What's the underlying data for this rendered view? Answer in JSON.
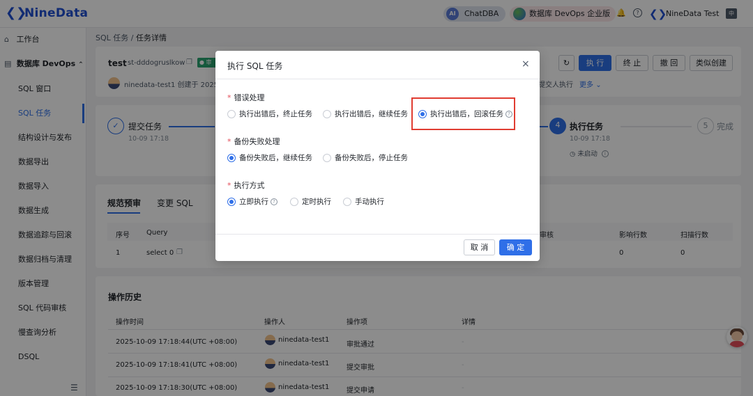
{
  "app": {
    "logo_text": "NineData",
    "chatdba": "ChatDBA",
    "chatdba_avatar": "AI",
    "devops_edition": "数据库 DevOps 企业版",
    "username": "NineData Test",
    "lang_icon": "中"
  },
  "sidebar": {
    "items": [
      {
        "label": "工作台",
        "icon": "home-icon"
      },
      {
        "label": "数据库 DevOps",
        "icon": "devops-icon"
      },
      {
        "label": "SQL 窗口"
      },
      {
        "label": "SQL 任务"
      },
      {
        "label": "结构设计与发布"
      },
      {
        "label": "数据导出"
      },
      {
        "label": "数据导入"
      },
      {
        "label": "数据生成"
      },
      {
        "label": "数据追踪与回滚"
      },
      {
        "label": "数据归档与清理"
      },
      {
        "label": "版本管理"
      },
      {
        "label": "SQL 代码审核"
      },
      {
        "label": "慢查询分析"
      },
      {
        "label": "DSQL"
      }
    ]
  },
  "breadcrumb": {
    "parent": "SQL 任务",
    "sep": "/",
    "current": "任务详情"
  },
  "task": {
    "name": "test",
    "id": "st-dddogruslkow",
    "status_badge": "审",
    "creator_text": "ninedata-test1 创建于 2025",
    "submitter_text": "提交人执行",
    "more": "更多",
    "buttons": {
      "refresh": "↻",
      "execute": "执 行",
      "terminate": "终 止",
      "revoke": "撤 回",
      "clone": "类似创建"
    }
  },
  "steps": [
    {
      "title": "提交任务",
      "time": "10-09 17:18"
    },
    {
      "num": "4",
      "title": "执行任务",
      "time": "10-09 17:18",
      "status": "未启动"
    },
    {
      "num": "5",
      "title": "完成"
    }
  ],
  "tabs": [
    "规范预审",
    "变更 SQL"
  ],
  "sql_table": {
    "headers": {
      "seq": "序号",
      "query": "Query",
      "review": "审核",
      "affected": "影响行数",
      "scanned": "扫描行数"
    },
    "rows": [
      {
        "seq": "1",
        "query": "select 0",
        "affected": "0",
        "scanned": "0"
      }
    ]
  },
  "history": {
    "title": "操作历史",
    "headers": {
      "time": "操作时间",
      "operator": "操作人",
      "action": "操作项",
      "detail": "详情"
    },
    "rows": [
      {
        "time": "2025-10-09 17:18:44(UTC +08:00)",
        "operator": "ninedata-test1",
        "action": "审批通过",
        "detail": "-"
      },
      {
        "time": "2025-10-09 17:18:41(UTC +08:00)",
        "operator": "ninedata-test1",
        "action": "提交审批",
        "detail": "-"
      },
      {
        "time": "2025-10-09 17:18:30(UTC +08:00)",
        "operator": "ninedata-test1",
        "action": "提交申请",
        "detail": "-"
      }
    ]
  },
  "modal": {
    "title": "执行 SQL 任务",
    "close": "×",
    "error_handling": {
      "label": "错误处理",
      "options": [
        "执行出错后，终止任务",
        "执行出错后，继续任务",
        "执行出错后，回滚任务"
      ],
      "selected": 2
    },
    "backup_failure": {
      "label": "备份失败处理",
      "options": [
        "备份失败后，继续任务",
        "备份失败后，停止任务"
      ],
      "selected": 0
    },
    "exec_mode": {
      "label": "执行方式",
      "options": [
        "立即执行",
        "定时执行",
        "手动执行"
      ],
      "selected": 0
    },
    "cancel": "取 消",
    "confirm": "确 定"
  },
  "colors": {
    "primary": "#2f6fe8",
    "highlight": "#e03c31",
    "brand": "#1f4fd1"
  }
}
